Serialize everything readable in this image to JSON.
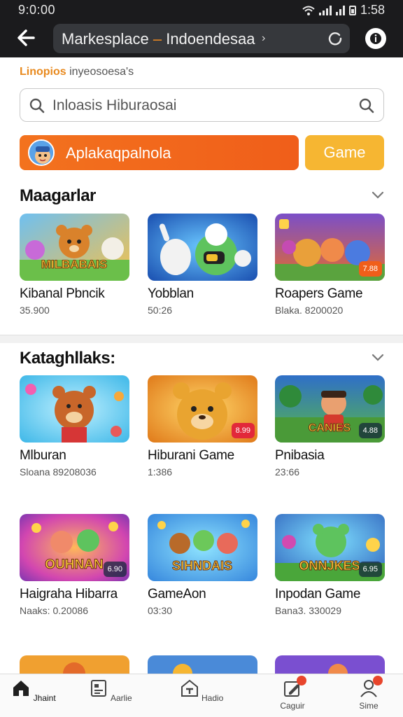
{
  "status": {
    "time": "9:0:00",
    "right_text": "1:58"
  },
  "appbar": {
    "title_a": "Markesplace ",
    "title_dash": "–",
    "title_b": " Indoendesaa",
    "chevron": "›"
  },
  "subtitle": {
    "accent": "Linopios",
    "rest": " inyeosoesa's"
  },
  "search": {
    "placeholder": "Inloasis Hiburaosai"
  },
  "buttons": {
    "app_label": "Aplakaqpalnola",
    "game_label": "Game"
  },
  "sections": [
    {
      "title": "Maagarlar",
      "cards": [
        {
          "name": "Kibanal Pbncik",
          "meta": "35.900",
          "badge": "",
          "thumb_text": "MILBABAIS"
        },
        {
          "name": "Yobblan",
          "meta": "50:26",
          "badge": "",
          "thumb_text": ""
        },
        {
          "name": "Roapers Game",
          "meta": "Blaka. 8200020",
          "badge": "7.88",
          "thumb_text": ""
        }
      ]
    },
    {
      "title": "Kataghllaks:",
      "cards": [
        {
          "name": "Mlburan",
          "meta": "Sloana 89208036",
          "badge": "",
          "thumb_text": ""
        },
        {
          "name": "Hiburani Game",
          "meta": "1:386",
          "badge": "8.99",
          "thumb_text": ""
        },
        {
          "name": "Pnibasia",
          "meta": "23:66",
          "badge": "4.88",
          "thumb_text": "CANIES"
        },
        {
          "name": "Haigraha Hibarra",
          "meta": "Naaks: 0.20086",
          "badge": "6.90",
          "thumb_text": "OUHNAN"
        },
        {
          "name": "GameAon",
          "meta": "03:30",
          "badge": "",
          "thumb_text": "SIHNDAIS"
        },
        {
          "name": "Inpodan Game",
          "meta": "Bana3. 330029",
          "badge": "6.95",
          "thumb_text": "ONNJKES"
        }
      ]
    }
  ],
  "bottom_nav": [
    {
      "label": "Jhaint",
      "icon": "home-icon"
    },
    {
      "label": "Aarlie",
      "icon": "document-icon"
    },
    {
      "label": "Hadio",
      "icon": "store-icon"
    },
    {
      "label": "Caguir",
      "icon": "edit-icon"
    },
    {
      "label": "Sime",
      "icon": "profile-icon"
    }
  ]
}
